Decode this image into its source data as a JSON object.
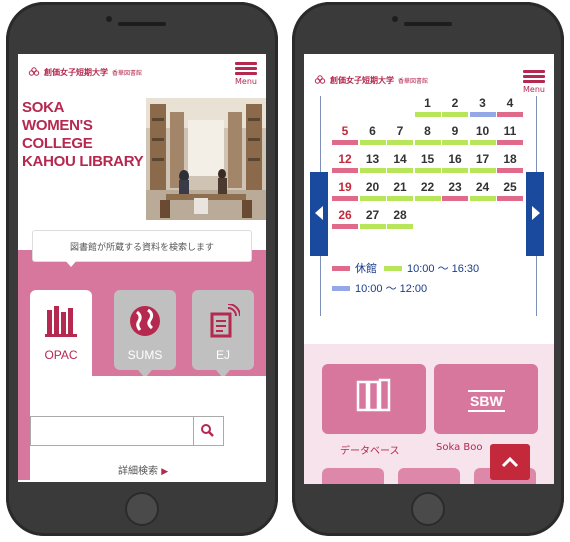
{
  "header": {
    "logo_text": "創価女子短期大学",
    "logo_sub": "香華図書館",
    "menu_label": "Menu"
  },
  "hero": {
    "title_lines": [
      "SOKA",
      "WOMEN'S",
      "COLLEGE",
      "KAHOU LIBRARY"
    ]
  },
  "search": {
    "caption": "図書館が所蔵する資料を検索します",
    "tabs": [
      {
        "label": "OPAC",
        "icon": "books-icon"
      },
      {
        "label": "SUMS",
        "icon": "globe-icon"
      },
      {
        "label": "EJ",
        "icon": "ejournal-icon"
      }
    ],
    "input_value": "",
    "advanced_label": "詳細検索"
  },
  "calendar": {
    "rows": [
      [
        {
          "d": "",
          "t": "none"
        },
        {
          "d": "",
          "t": "none"
        },
        {
          "d": "",
          "t": "none"
        },
        {
          "d": "1",
          "t": "open"
        },
        {
          "d": "2",
          "t": "open"
        },
        {
          "d": "3",
          "t": "short"
        },
        {
          "d": "4",
          "t": "closed"
        }
      ],
      [
        {
          "d": "5",
          "t": "closed",
          "red": true
        },
        {
          "d": "6",
          "t": "open"
        },
        {
          "d": "7",
          "t": "open"
        },
        {
          "d": "8",
          "t": "open"
        },
        {
          "d": "9",
          "t": "open"
        },
        {
          "d": "10",
          "t": "open"
        },
        {
          "d": "11",
          "t": "closed"
        }
      ],
      [
        {
          "d": "12",
          "t": "closed",
          "red": true
        },
        {
          "d": "13",
          "t": "open"
        },
        {
          "d": "14",
          "t": "open"
        },
        {
          "d": "15",
          "t": "open"
        },
        {
          "d": "16",
          "t": "open"
        },
        {
          "d": "17",
          "t": "open"
        },
        {
          "d": "18",
          "t": "closed"
        }
      ],
      [
        {
          "d": "19",
          "t": "closed",
          "red": true
        },
        {
          "d": "20",
          "t": "open"
        },
        {
          "d": "21",
          "t": "open"
        },
        {
          "d": "22",
          "t": "open"
        },
        {
          "d": "23",
          "t": "closed"
        },
        {
          "d": "24",
          "t": "open"
        },
        {
          "d": "25",
          "t": "closed"
        }
      ],
      [
        {
          "d": "26",
          "t": "closed",
          "red": true
        },
        {
          "d": "27",
          "t": "open"
        },
        {
          "d": "28",
          "t": "open"
        },
        {
          "d": "",
          "t": "none"
        },
        {
          "d": "",
          "t": "none"
        },
        {
          "d": "",
          "t": "none"
        },
        {
          "d": "",
          "t": "none"
        }
      ]
    ],
    "legend": [
      {
        "label": "休館",
        "type": "closed"
      },
      {
        "label": "10:00 ～ 16:30",
        "type": "open"
      },
      {
        "label": "10:00 ～ 12:00",
        "type": "short"
      }
    ],
    "colors": {
      "closed": "#e06a8a",
      "open": "#b8e65a",
      "short": "#94a8e8"
    }
  },
  "links": {
    "database_label": "データベース",
    "sbw_label": "Soka Boo",
    "sbw_badge": "SBW"
  },
  "colors": {
    "brand": "#b5284f",
    "pink_panel": "#d8779d",
    "nav_blue": "#1a4a9e",
    "totop_red": "#c4283b"
  }
}
